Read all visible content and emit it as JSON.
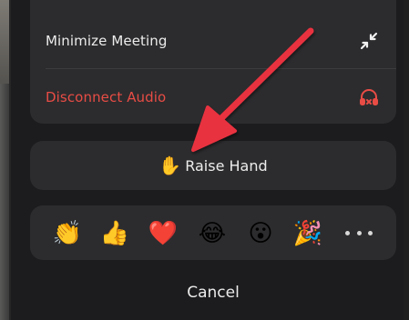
{
  "menu": {
    "minimize_label": "Minimize Meeting",
    "minimize_icon": "minimize-arrows-icon",
    "disconnect_label": "Disconnect Audio",
    "disconnect_icon": "headphones-x-icon",
    "disconnect_color": "#e84c45"
  },
  "raise_hand": {
    "emoji": "✋",
    "label": "Raise Hand"
  },
  "reactions": [
    {
      "emoji": "👏",
      "name": "clapping-hands-icon"
    },
    {
      "emoji": "👍",
      "name": "thumbs-up-icon"
    },
    {
      "emoji": "❤️",
      "name": "red-heart-icon"
    },
    {
      "emoji": "😂",
      "name": "tears-of-joy-icon"
    },
    {
      "emoji": "😮",
      "name": "surprised-face-icon"
    },
    {
      "emoji": "🎉",
      "name": "party-popper-icon"
    }
  ],
  "more_icon": "more-dots-icon",
  "cancel_label": "Cancel",
  "annotation": {
    "arrow_color": "#e8323f",
    "arrow_icon": "annotation-arrow"
  }
}
